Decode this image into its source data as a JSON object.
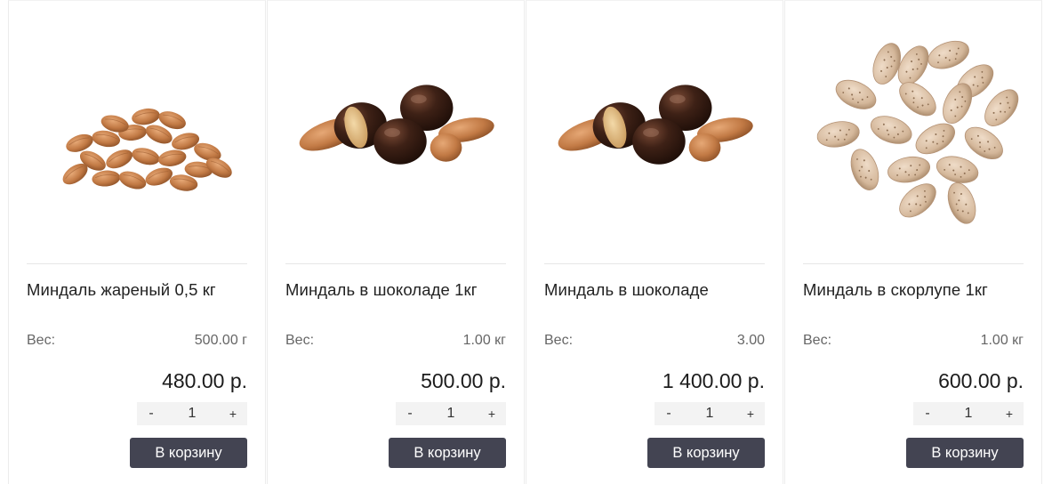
{
  "products": [
    {
      "title": "Миндаль жареный 0,5 кг",
      "weight_label": "Вес:",
      "weight_value": "500.00 г",
      "price": "480.00 р.",
      "qty_minus": "-",
      "qty_value": "1",
      "qty_plus": "+",
      "cart_label": "В корзину",
      "image": "roasted-almonds-pile"
    },
    {
      "title": "Миндаль в шоколаде 1кг",
      "weight_label": "Вес:",
      "weight_value": "1.00 кг",
      "price": "500.00 р.",
      "qty_minus": "-",
      "qty_value": "1",
      "qty_plus": "+",
      "cart_label": "В корзину",
      "image": "chocolate-covered-almonds"
    },
    {
      "title": "Миндаль в шоколаде",
      "weight_label": "Вес:",
      "weight_value": "3.00",
      "price": "1 400.00 р.",
      "qty_minus": "-",
      "qty_value": "1",
      "qty_plus": "+",
      "cart_label": "В корзину",
      "image": "chocolate-covered-almonds"
    },
    {
      "title": "Миндаль в скорлупе 1кг",
      "weight_label": "Вес:",
      "weight_value": "1.00 кг",
      "price": "600.00 р.",
      "qty_minus": "-",
      "qty_value": "1",
      "qty_plus": "+",
      "cart_label": "В корзину",
      "image": "almonds-in-shell"
    }
  ],
  "colors": {
    "button_bg": "#434452",
    "almond": "#c8834f",
    "chocolate": "#3b1f14",
    "shell": "#d8bfa6"
  }
}
